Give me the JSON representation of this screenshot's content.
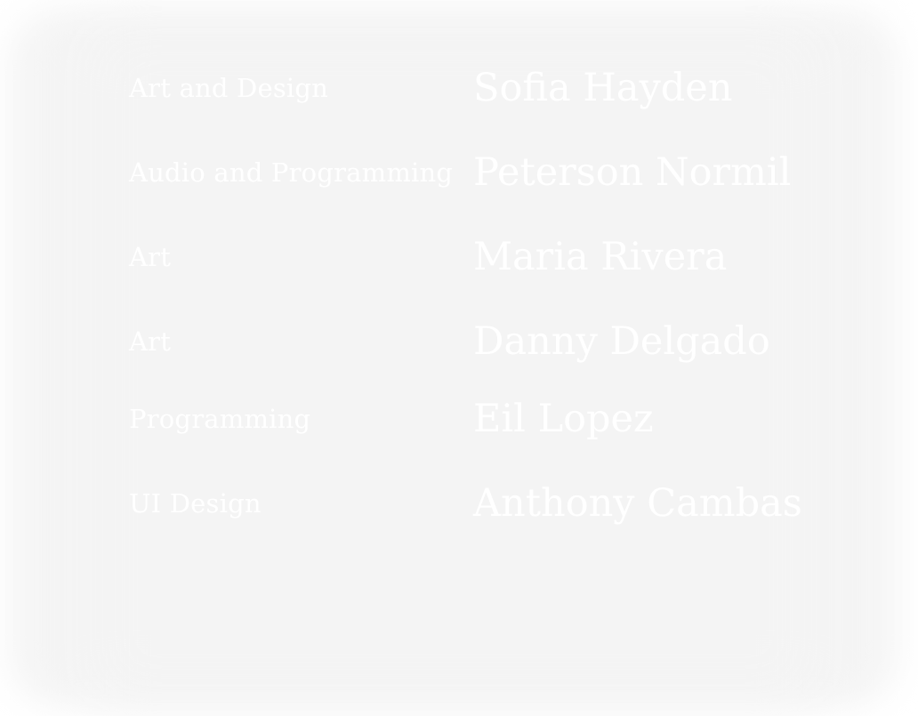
{
  "credits": [
    {
      "role": "Art and Design",
      "name": "Sofia Hayden"
    },
    {
      "role": "Audio and Programming",
      "name": "Peterson Normil"
    },
    {
      "role": "Art",
      "name": "Maria Rivera"
    },
    {
      "role": "Art",
      "name": "Danny Delgado"
    },
    {
      "role": "Programming",
      "name": "Eil Lopez"
    },
    {
      "role": "UI Design",
      "name": "Anthony Cambas"
    }
  ]
}
